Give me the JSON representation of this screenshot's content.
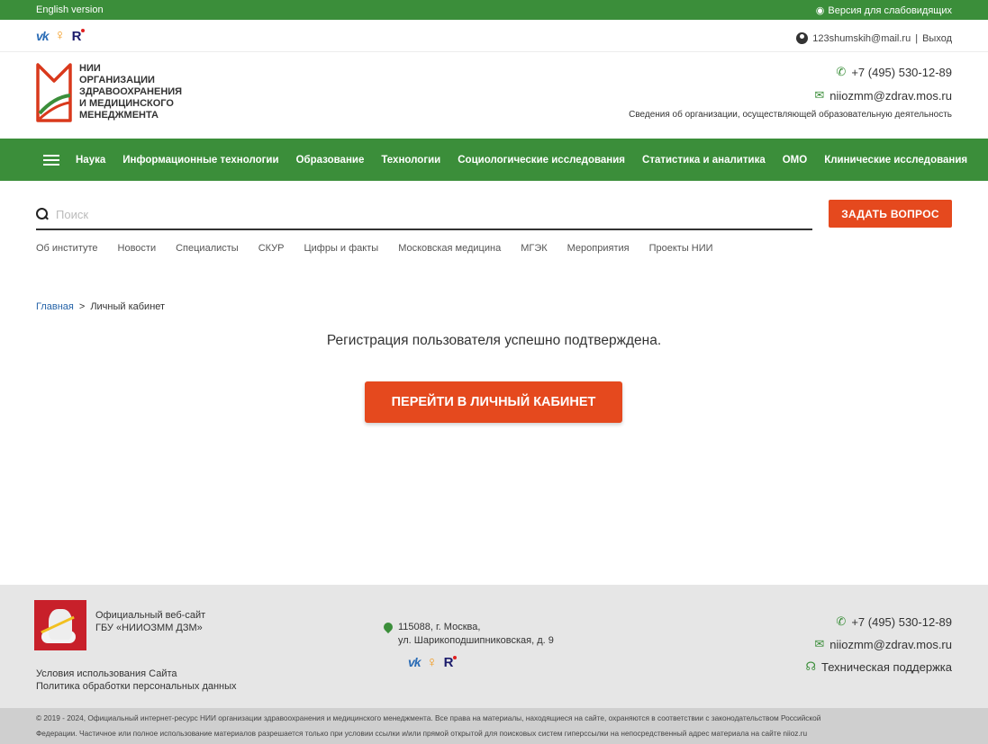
{
  "topbar": {
    "english": "English version",
    "blind_version": "Версия для слабовидящих"
  },
  "header": {
    "user_email": "123shumskih@mail.ru",
    "separator": " | ",
    "logout": "Выход",
    "logo_lines": [
      "НИИ",
      "ОРГАНИЗАЦИИ",
      "ЗДРАВООХРАНЕНИЯ",
      "И МЕДИЦИНСКОГО",
      "МЕНЕДЖМЕНТА"
    ],
    "phone": "+7 (495) 530-12-89",
    "email": "niiozmm@zdrav.mos.ru",
    "org_info": "Сведения об организации, осуществляющей образовательную деятельность"
  },
  "social": {
    "vk": "vk",
    "ok": "ok",
    "rutube": "R"
  },
  "main_nav": [
    "Наука",
    "Информационные технологии",
    "Образование",
    "Технологии",
    "Социологические исследования",
    "Статистика и аналитика",
    "ОМО",
    "Клинические исследования"
  ],
  "search": {
    "placeholder": "Поиск",
    "value": ""
  },
  "ask_button": "ЗАДАТЬ ВОПРОС",
  "sub_nav": [
    "Об институте",
    "Новости",
    "Специалисты",
    "СКУР",
    "Цифры и факты",
    "Московская медицина",
    "МГЭК",
    "Мероприятия",
    "Проекты НИИ"
  ],
  "breadcrumb": {
    "home": "Главная",
    "sep": ">",
    "current": "Личный кабинет"
  },
  "content": {
    "message": "Регистрация пользователя успешно подтверждена.",
    "button": "ПЕРЕЙТИ В ЛИЧНЫЙ КАБИНЕТ"
  },
  "footer": {
    "site_line1": "Официальный веб-сайт",
    "site_line2": "ГБУ «НИИОЗММ ДЗМ»",
    "terms": "Условия использования Сайта",
    "privacy": "Политика обработки персональных данных",
    "address_line1": "115088, г. Москва,",
    "address_line2": "ул. Шарикоподшипниковская, д. 9",
    "phone": "+7 (495) 530-12-89",
    "email": "niiozmm@zdrav.mos.ru",
    "support": "Техническая поддержка",
    "copyright_line1": "© 2019 - 2024, Официальный интернет-ресурс НИИ организации здравоохранения и медицинского менеджмента. Все права на материалы, находящиеся на сайте, охраняются в соответствии с законодательством Российской",
    "copyright_line2": "Федерации. Частичное или полное использование материалов разрешается только при условии ссылки и/или прямой открытой для поисковых систем гиперссылки на непосредственный адрес материала на сайте niioz.ru"
  },
  "colors": {
    "green": "#3b8e3a",
    "orange": "#e5491e",
    "footer_bg": "#e6e6e6"
  }
}
